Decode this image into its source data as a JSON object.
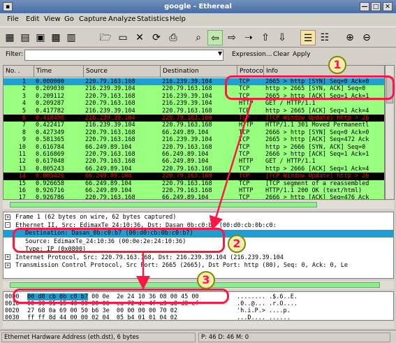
{
  "window": {
    "title": "google - Ethereal",
    "buttons": [
      "—",
      "□",
      "✕"
    ]
  },
  "menu": [
    "File",
    "Edit",
    "View",
    "Go",
    "Capture",
    "Analyze",
    "Statistics",
    "Help"
  ],
  "toolbar_icons": [
    "interfaces-icon",
    "capture-options-icon",
    "start-icon",
    "stop-icon",
    "restart-icon",
    "open-icon",
    "save-icon",
    "close-file-icon",
    "reload-icon",
    "print-icon",
    "find-icon",
    "back-icon",
    "forward-icon",
    "goto-icon",
    "first-icon",
    "last-icon",
    "colorize-icon",
    "autoscroll-icon",
    "zoom-in-icon",
    "zoom-out-icon"
  ],
  "filter": {
    "label": "Filter:",
    "value": "",
    "expression": "Expression...",
    "clear": "Clear",
    "apply": "Apply"
  },
  "columns": [
    "No. .",
    "Time",
    "Source",
    "Destination",
    "Protocol",
    "Info"
  ],
  "packets": [
    {
      "no": "1",
      "time": "0.000000",
      "src": "220.79.163.168",
      "dst": "216.239.39.104",
      "proto": "TCP",
      "info": "2665 > http [SYN] Seq=0 Ack=0",
      "color": "#1e9fd1"
    },
    {
      "no": "2",
      "time": "0.209030",
      "src": "216.239.39.104",
      "dst": "220.79.163.168",
      "proto": "TCP",
      "info": "http > 2665 [SYN, ACK] Seq=0",
      "color": "#99ff7f"
    },
    {
      "no": "3",
      "time": "0.209112",
      "src": "220.79.163.168",
      "dst": "216.239.39.104",
      "proto": "TCP",
      "info": "2665 > http [ACK] Seq=1 Ack=1",
      "color": "#99ff7f"
    },
    {
      "no": "4",
      "time": "0.209287",
      "src": "220.79.163.168",
      "dst": "216.239.39.104",
      "proto": "HTTP",
      "info": "GET / HTTP/1.1",
      "color": "#99ff7f"
    },
    {
      "no": "5",
      "time": "0.417782",
      "src": "216.239.39.104",
      "dst": "220.79.163.168",
      "proto": "TCP",
      "info": "http > 2665 [ACK] Seq=1 Ack=4",
      "color": "#99ff7f"
    },
    {
      "no": "6",
      "time": "0.418450",
      "src": "216.239.39.104",
      "dst": "220.79.163.168",
      "proto": "TCP",
      "info": "[TCP Window Update] http > 26",
      "color": "#000000"
    },
    {
      "no": "7",
      "time": "0.422417",
      "src": "216.239.39.104",
      "dst": "220.79.163.168",
      "proto": "HTTP",
      "info": "HTTP/1.1 301 Moved Permanentl",
      "color": "#99ff7f"
    },
    {
      "no": "8",
      "time": "0.427349",
      "src": "220.79.163.168",
      "dst": "66.249.89.104",
      "proto": "TCP",
      "info": "2666 > http [SYN] Seq=0 Ack=0",
      "color": "#99ff7f"
    },
    {
      "no": "9",
      "time": "0.581365",
      "src": "220.79.163.168",
      "dst": "216.239.39.104",
      "proto": "TCP",
      "info": "2665 > http [ACK] Seq=472 Ack",
      "color": "#99ff7f"
    },
    {
      "no": "10",
      "time": "0.616784",
      "src": "66.249.89.104",
      "dst": "220.79.163.168",
      "proto": "TCP",
      "info": "http > 2666 [SYN, ACK] Seq=0",
      "color": "#99ff7f"
    },
    {
      "no": "11",
      "time": "0.616869",
      "src": "220.79.163.168",
      "dst": "66.249.89.104",
      "proto": "TCP",
      "info": "2666 > http [ACK] Seq=1 Ack=1",
      "color": "#99ff7f"
    },
    {
      "no": "12",
      "time": "0.617048",
      "src": "220.79.163.168",
      "dst": "66.249.89.104",
      "proto": "HTTP",
      "info": "GET / HTTP/1.1",
      "color": "#99ff7f"
    },
    {
      "no": "13",
      "time": "0.805243",
      "src": "66.249.89.104",
      "dst": "220.79.163.168",
      "proto": "TCP",
      "info": "http > 2666 [ACK] Seq=1 Ack=4",
      "color": "#99ff7f"
    },
    {
      "no": "14",
      "time": "0.805426",
      "src": "66.249.89.104",
      "dst": "220.79.163.168",
      "proto": "TCP",
      "info": "[TCP Window Update] http > 26",
      "color": "#000000"
    },
    {
      "no": "15",
      "time": "0.926658",
      "src": "66.249.89.104",
      "dst": "220.79.163.168",
      "proto": "TCP",
      "info": "[TCP segment of a reassembled",
      "color": "#99ff7f"
    },
    {
      "no": "16",
      "time": "0.926716",
      "src": "66.249.89.104",
      "dst": "220.79.163.168",
      "proto": "HTTP",
      "info": "HTTP/1.1 200 OK (text/html)",
      "color": "#99ff7f"
    },
    {
      "no": "17",
      "time": "0.926786",
      "src": "220.79.163.168",
      "dst": "66.249.89.104",
      "proto": "TCP",
      "info": "2666 > http [ACK] Seq=476 Ack",
      "color": "#99ff7f"
    }
  ],
  "details": [
    {
      "text": "Frame 1 (62 bytes on wire, 62 bytes captured)",
      "indent": 0,
      "exp": "+",
      "sel": false
    },
    {
      "text": "Ethernet II, Src: EdimaxTe_24:10:36, Dst: Dasan_0b:c0:b7 (00:d0:cb:0b:c0:",
      "indent": 0,
      "exp": "-",
      "sel": false
    },
    {
      "text": "Destination: Dasan_0b:c0:b7 (00:d0:cb:0b:c0:b7)",
      "indent": 1,
      "exp": "",
      "sel": true
    },
    {
      "text": "Source: EdimaxTe_24:10:36 (00:0e:2e:24:10:36)",
      "indent": 1,
      "exp": "",
      "sel": false
    },
    {
      "text": "Type: IP (0x0800)",
      "indent": 1,
      "exp": "",
      "sel": false
    },
    {
      "text": "Internet Protocol, Src: 220.79.163.168, Dst: 216.239.39.104 (216.239.39.104",
      "indent": 0,
      "exp": "+",
      "sel": false
    },
    {
      "text": "Transmission Control Protocol, Src Port: 2665 (2665), Dst Port: http (80), Seq: 0, Ack: 0, Le",
      "indent": 0,
      "exp": "+",
      "sel": false
    }
  ],
  "bytes": [
    {
      "off": "0000",
      "hex": "00 d0 cb 0b c0 b7 00 0e  2e 24 10 36 08 00 45 00",
      "ascii": "........ .$.6..E."
    },
    {
      "off": "0010",
      "hex": "00 30 95 15 40 00 80 06  ea 72 dc 4f a3 a8 d8 ef",
      "ascii": ".0..@... .r.O...."
    },
    {
      "off": "0020",
      "hex": "27 68 0a 69 00 50 b6 3e  00 00 00 00 70 02",
      "ascii": "'h.i.P.> ....p."
    },
    {
      "off": "0030",
      "hex": "ff ff 8d 44 00 00 02 04  05 b4 01 01 04 02",
      "ascii": "...D.... ......"
    }
  ],
  "status": {
    "left": "Ethernet Hardware Address (eth.dst), 6 bytes",
    "right": "P: 46 D: 46 M: 0"
  },
  "annotations": [
    "1",
    "2",
    "3"
  ]
}
